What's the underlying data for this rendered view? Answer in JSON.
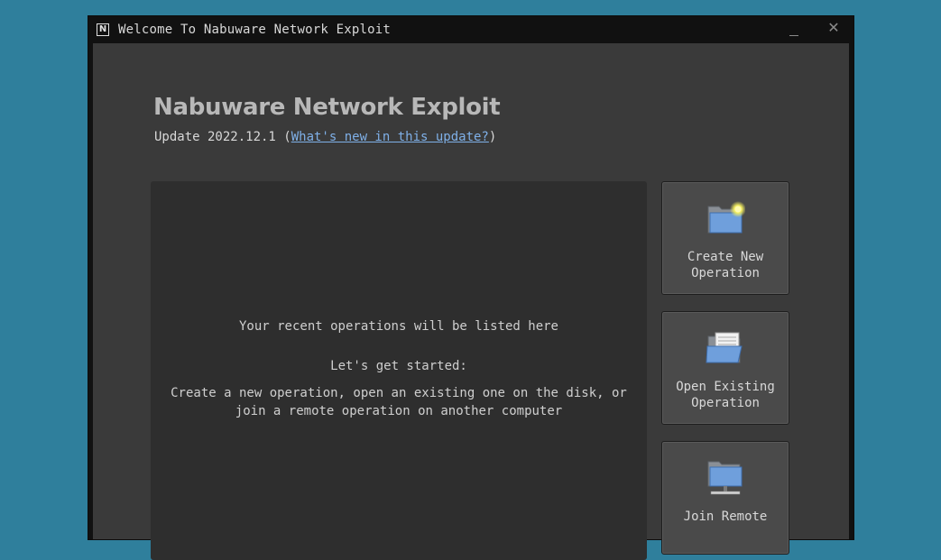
{
  "window": {
    "title": "Welcome To Nabuware Network Exploit",
    "icon_letter": "N",
    "close_glyph": "✕"
  },
  "header": {
    "app_name": "Nabuware Network Exploit",
    "update_prefix": "Update 2022.12.1 (",
    "update_link": "What's new in this update?",
    "update_suffix": ")"
  },
  "recent": {
    "empty_message": "Your recent operations will be listed here",
    "lets_get_started": "Let's get started:",
    "instructions_line1": "Create a new operation, open an existing one on the disk, or",
    "instructions_line2": "join a remote operation on another computer"
  },
  "actions": {
    "create": {
      "line1": "Create New",
      "line2": "Operation",
      "icon": "folder-new-icon"
    },
    "open": {
      "line1": "Open Existing",
      "line2": "Operation",
      "icon": "folder-open-icon"
    },
    "join": {
      "line1": "Join Remote",
      "line2": "",
      "icon": "network-folder-icon"
    }
  },
  "colors": {
    "desktop": "#2f7f9c",
    "window_bg": "#3a3a3a",
    "panel_bg": "#2e2e2e",
    "link": "#7fb0e8",
    "folder_blue": "#6f9fdc"
  }
}
